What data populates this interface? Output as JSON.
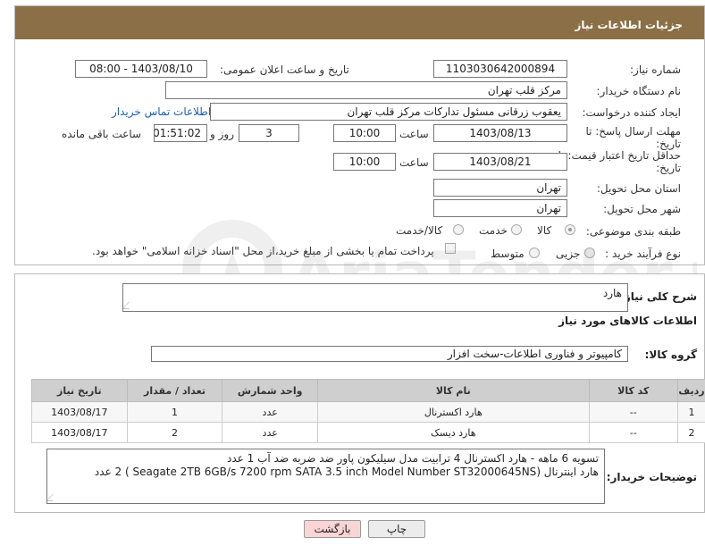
{
  "header": {
    "title": "جزئیات اطلاعات نیاز"
  },
  "form": {
    "need_number_label": "شماره نیاز:",
    "need_number": "1103030642000894",
    "announce_label": "تاریخ و ساعت اعلان عمومی:",
    "announce_value": "1403/08/10 - 08:00",
    "buyer_org_label": "نام دستگاه خریدار:",
    "buyer_org": "مرکز قلب تهران",
    "requester_label": "ایجاد کننده درخواست:",
    "requester": "یعقوب زرقانی مسئول تدارکات مرکز قلب تهران",
    "contact_link": "اطلاعات تماس خریدار",
    "reply_deadline_label_1": "مهلت ارسال پاسخ: تا",
    "reply_deadline_label_2": "تاریخ:",
    "reply_date": "1403/08/13",
    "time_label": "ساعت",
    "reply_time": "10:00",
    "days_value": "3",
    "days_label": "روز و",
    "remaining_value": "01:51:02",
    "remaining_label": "ساعت باقی مانده",
    "price_validity_label_1": "حداقل تاریخ اعتبار قیمت: تا",
    "price_validity_label_2": "تاریخ:",
    "price_date": "1403/08/21",
    "price_time": "10:00",
    "province_label": "استان محل تحویل:",
    "province": "تهران",
    "city_label": "شهر محل تحویل:",
    "city": "تهران",
    "category_label": "طبقه بندی موضوعی:",
    "category_options": [
      "کالا",
      "خدمت",
      "کالا/خدمت"
    ],
    "category_selected": "کالا",
    "process_label": "نوع فرآیند خرید :",
    "process_options": [
      "جزیی",
      "متوسط"
    ],
    "payment_note": "پرداخت تمام یا بخشی از مبلغ خرید،از محل \"اسناد خزانه اسلامی\" خواهد بود."
  },
  "details": {
    "summary_label": "شرح کلی نیاز:",
    "summary": "هارد",
    "goods_info_title": "اطلاعات کالاهای مورد نیاز",
    "group_label": "گروه کالا:",
    "group_value": "کامپیوتر و فناوری اطلاعات-سخت افزار",
    "table": {
      "headers": [
        "ردیف",
        "کد کالا",
        "نام کالا",
        "واحد شمارش",
        "تعداد / مقدار",
        "تاریخ نیاز"
      ],
      "rows": [
        [
          "1",
          "--",
          "هارد اکسترنال",
          "عدد",
          "1",
          "1403/08/17"
        ],
        [
          "2",
          "--",
          "هارد دیسک",
          "عدد",
          "2",
          "1403/08/17"
        ]
      ]
    },
    "buyer_notes_label": "توضیحات خریدار:",
    "buyer_notes_line1": "تسویه 6 ماهه - هارد اکسترنال 4 ترابیت مدل سیلیکون پاور ضد ضربه ضد آب 1 عدد",
    "buyer_notes_line2": "هارد اینترنال  (Seagate 2TB 6GB/s 7200 rpm SATA 3.5 inch Model Number ST32000645NS ) 2 عدد"
  },
  "buttons": {
    "print": "چاپ",
    "back": "بازگشت"
  },
  "watermark_text": "AriaTender.net",
  "colors": {
    "title_bar": "#8b6f46",
    "link": "#1a5fb4",
    "back_button": "#f9d5d5"
  }
}
